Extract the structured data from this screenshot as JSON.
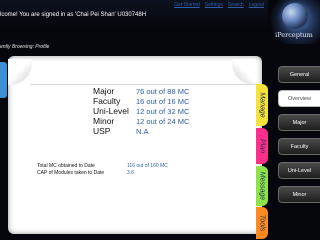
{
  "header": {
    "welcome": "lcome! You are signed in as 'Chai Pei Shan' U030748H",
    "links": [
      "Get Started",
      "Settings",
      "Search",
      "Logout"
    ],
    "logo_text": "iPerceptum",
    "browsing": "ently Browsing: Profile"
  },
  "summary": {
    "rows": [
      {
        "label": "Major",
        "value": "76 out of 88 MC"
      },
      {
        "label": "Faculty",
        "value": "16 out of 16 MC"
      },
      {
        "label": "Uni-Level",
        "value": "12 out of 32 MC"
      },
      {
        "label": "Minor",
        "value": "12 out of 24 MC"
      },
      {
        "label": "USP",
        "value": "N.A"
      }
    ],
    "totals": [
      {
        "label": "Total MC obtained to Date",
        "value": "116 out of 160 MC"
      },
      {
        "label": "CAP of Modules taken to Date",
        "value": "3.6"
      }
    ]
  },
  "side_tabs": [
    {
      "label": "Manage",
      "color": "#f4e23a"
    },
    {
      "label": "Plan",
      "color": "#ff2f8c"
    },
    {
      "label": "Message",
      "color": "#8ee34a"
    },
    {
      "label": "Tools",
      "color": "#ff8a1f"
    }
  ],
  "right_nav": [
    {
      "label": "General",
      "active": false
    },
    {
      "label": "Overview",
      "active": true
    },
    {
      "label": "Major",
      "active": false
    },
    {
      "label": "Faculty",
      "active": false
    },
    {
      "label": "Uni-Level",
      "active": false
    },
    {
      "label": "Minor",
      "active": false
    }
  ]
}
